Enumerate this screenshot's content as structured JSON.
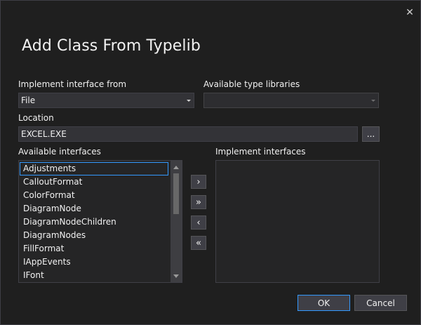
{
  "dialog": {
    "title": "Add Class From Typelib",
    "close_glyph": "✕"
  },
  "implement_from": {
    "label": "Implement interface from",
    "selected": "File"
  },
  "type_libraries": {
    "label": "Available type libraries",
    "selected": ""
  },
  "location": {
    "label": "Location",
    "value": "EXCEL.EXE",
    "browse_label": "..."
  },
  "available_interfaces": {
    "label": "Available interfaces",
    "items": [
      "Adjustments",
      "CalloutFormat",
      "ColorFormat",
      "DiagramNode",
      "DiagramNodeChildren",
      "DiagramNodes",
      "FillFormat",
      "IAppEvents",
      "IFont"
    ],
    "selected_index": 0
  },
  "implement_interfaces": {
    "label": "Implement interfaces",
    "items": []
  },
  "transfer_buttons": {
    "add": "›",
    "add_all": "»",
    "remove": "‹",
    "remove_all": "«"
  },
  "buttons": {
    "ok": "OK",
    "cancel": "Cancel"
  },
  "colors": {
    "background": "#1f1f1f",
    "accent": "#3399ff",
    "control": "#333337",
    "border": "#3f3f46"
  }
}
